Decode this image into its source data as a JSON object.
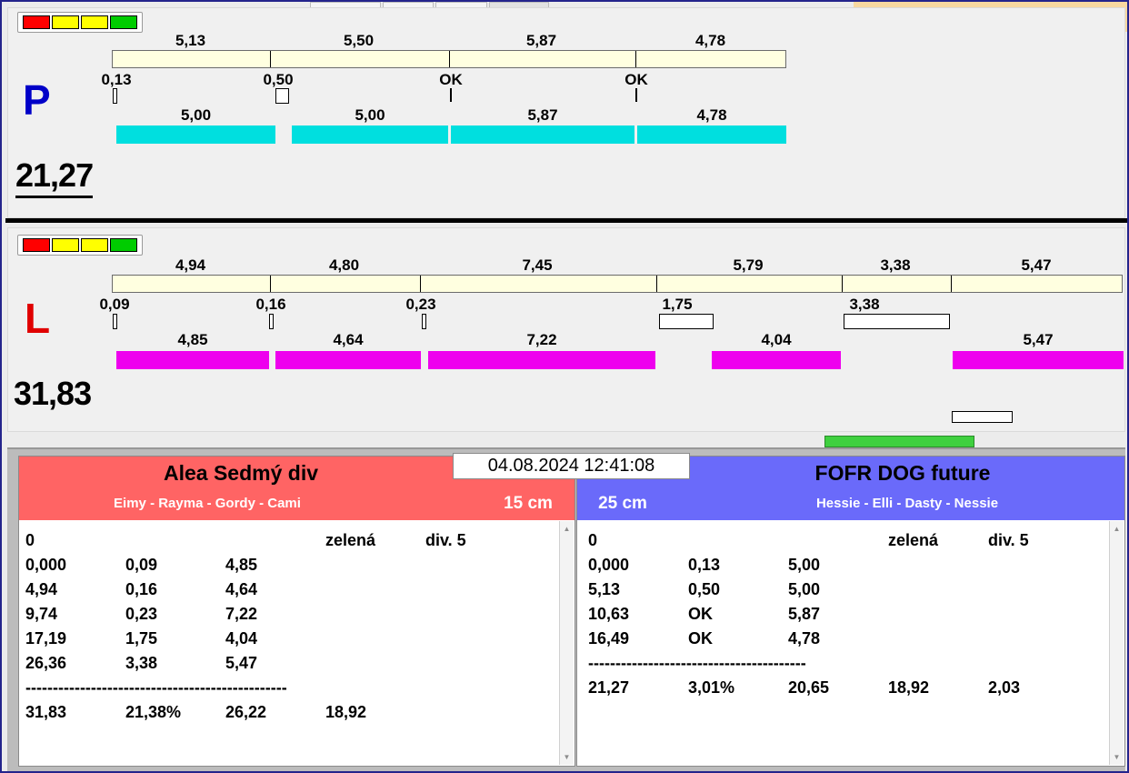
{
  "colors": {
    "lane_p_run_bar": "#00dfdf",
    "lane_l_run_bar": "#ee00ee",
    "segment_bar": "#ffffe0",
    "left_header": "#ff6464",
    "right_header": "#6a6afa",
    "light_red": "#ff0000",
    "light_yellow": "#ffff00",
    "light_green": "#00cc00",
    "ready_bar_green": "#3fd03f",
    "p_letter_blue": "#0000c8",
    "l_letter_red": "#e00000"
  },
  "timestamp": "04.08.2024 12:41:08",
  "lane_p": {
    "letter": "P",
    "total": "21,27",
    "segment_values": [
      "5,13",
      "5,50",
      "5,87",
      "4,78"
    ],
    "split_values": [
      "0,13",
      "0,50",
      "OK",
      "OK"
    ],
    "run_values": [
      "5,00",
      "5,00",
      "5,87",
      "4,78"
    ]
  },
  "lane_l": {
    "letter": "L",
    "total": "31,83",
    "segment_values": [
      "4,94",
      "4,80",
      "7,45",
      "5,79",
      "3,38",
      "5,47"
    ],
    "split_values": [
      "0,09",
      "0,16",
      "0,23",
      "1,75",
      "3,38"
    ],
    "run_values": [
      "4,85",
      "4,64",
      "7,22",
      "4,04",
      "5,47"
    ]
  },
  "left_panel": {
    "title": "Alea Sedmý div",
    "team": "Eimy - Rayma - Gordy - Cami",
    "jump_height": "15 cm",
    "rows": [
      {
        "cells": [
          "0",
          "",
          "",
          "zelená",
          "div. 5"
        ]
      },
      {
        "cells": [
          "0,000",
          "0,09",
          "4,85"
        ]
      },
      {
        "cells": [
          "4,94",
          "0,16",
          "4,64"
        ]
      },
      {
        "cells": [
          "9,74",
          "0,23",
          "7,22"
        ]
      },
      {
        "cells": [
          "17,19",
          "1,75",
          "4,04"
        ]
      },
      {
        "cells": [
          "26,36",
          "3,38",
          "5,47"
        ]
      },
      {
        "dash": "------------------------------------------------"
      },
      {
        "cells": [
          "31,83",
          "21,38%",
          "26,22",
          "18,92"
        ]
      }
    ]
  },
  "right_panel": {
    "title": "FOFR DOG future",
    "team": "Hessie - Elli - Dasty - Nessie",
    "jump_height": "25 cm",
    "rows": [
      {
        "cells": [
          "0",
          "",
          "",
          "zelená",
          "div. 5"
        ]
      },
      {
        "cells": [
          "0,000",
          "0,13",
          "5,00"
        ]
      },
      {
        "cells": [
          "5,13",
          "0,50",
          "5,00"
        ]
      },
      {
        "cells": [
          "10,63",
          "OK",
          "5,87"
        ]
      },
      {
        "cells": [
          "16,49",
          "OK",
          "4,78"
        ]
      },
      {
        "dash": "----------------------------------------"
      },
      {
        "cells": [
          "21,27",
          "3,01%",
          "20,65",
          "18,92",
          "2,03"
        ]
      }
    ]
  }
}
